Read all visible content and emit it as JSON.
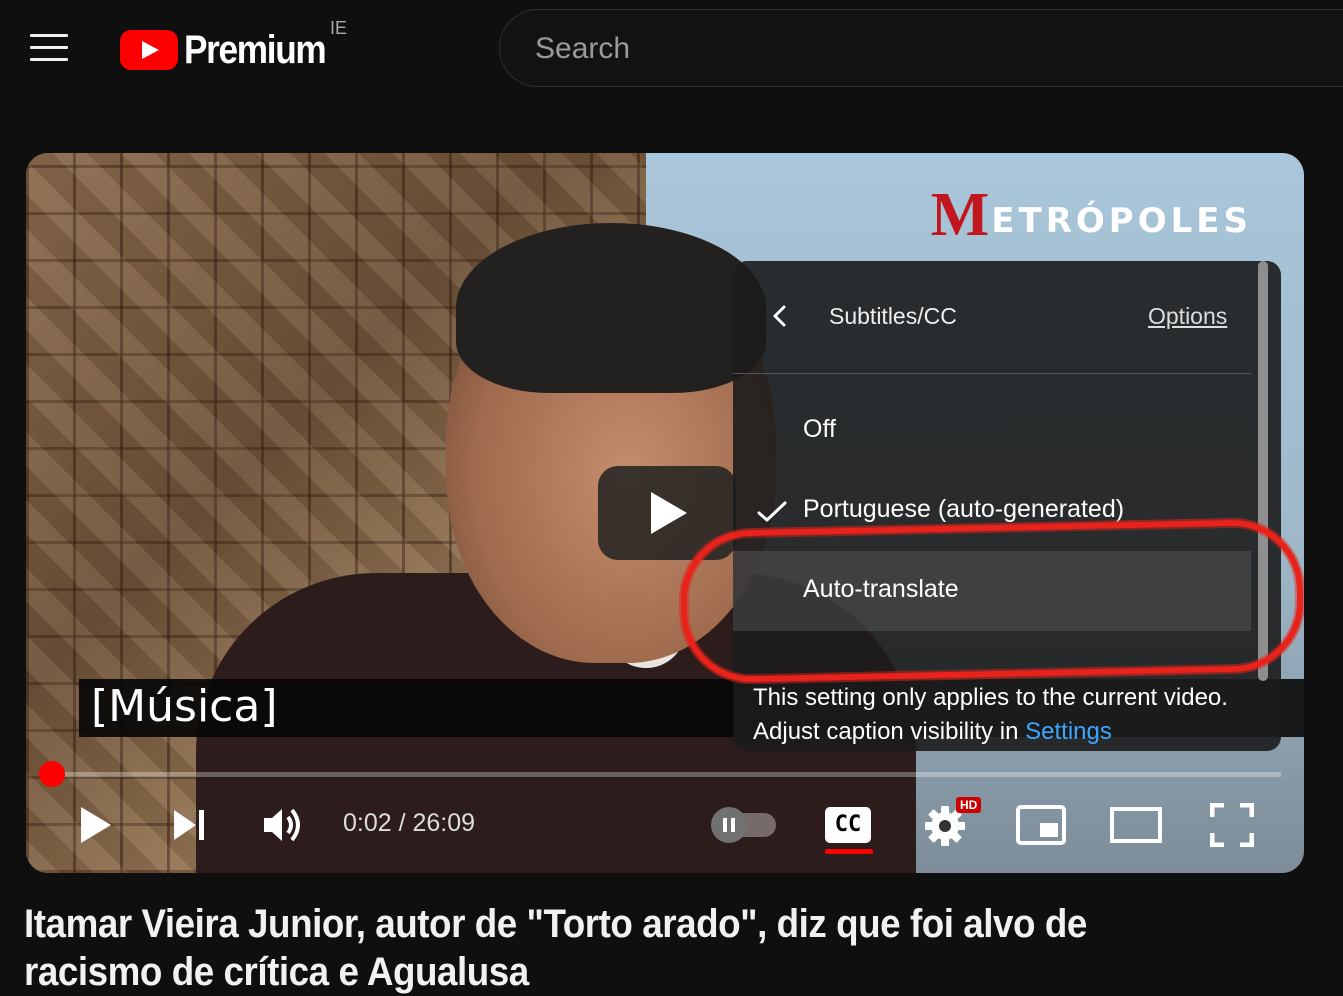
{
  "header": {
    "logo_text": "Premium",
    "country_code": "IE",
    "search_placeholder": "Search"
  },
  "player": {
    "channel_watermark": {
      "first_letter": "M",
      "rest": "ETRÓPOLES"
    },
    "caption_text": "[Música]",
    "progress": {
      "current_seconds": 2,
      "duration_seconds": 1569
    },
    "time_display": "0:02 / 26:09",
    "controls": {
      "play_icon": "play-icon",
      "next_icon": "skip-next-icon",
      "volume_icon": "volume-icon",
      "autoplay_icon": "autoplay-toggle-icon",
      "cc_label": "CC",
      "settings_icon": "gear-icon",
      "hd_badge": "HD",
      "miniplayer_icon": "miniplayer-icon",
      "theater_icon": "theater-mode-icon",
      "fullscreen_icon": "fullscreen-icon"
    },
    "subtitles_menu": {
      "title": "Subtitles/CC",
      "options_link": "Options",
      "items": [
        {
          "label": "Off",
          "selected": false
        },
        {
          "label": "Portuguese (auto-generated)",
          "selected": true
        },
        {
          "label": "Auto-translate",
          "selected": false,
          "highlighted": true
        }
      ],
      "info_text": "This setting only applies to the current video. Adjust caption visibility in",
      "info_link": "Settings"
    }
  },
  "video": {
    "title": "Itamar Vieira Junior, autor de \"Torto arado\", diz que foi alvo de racismo de crítica e Agualusa"
  },
  "colors": {
    "background": "#0f0f0f",
    "accent_red": "#ff0000",
    "link_blue": "#3ea6ff",
    "annotation_red": "#e8231b"
  }
}
